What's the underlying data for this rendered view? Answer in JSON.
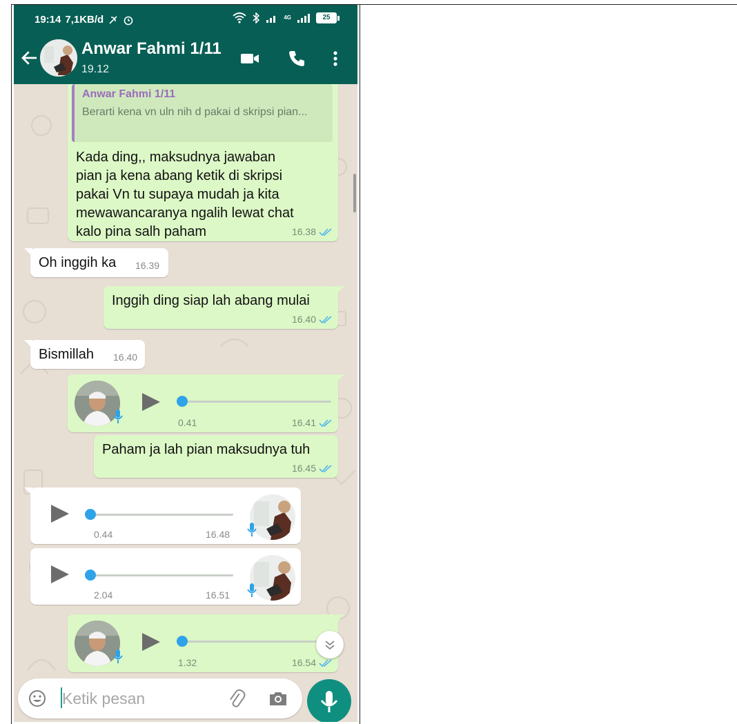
{
  "status_bar": {
    "time": "19:14",
    "speed": "7,1KB/d",
    "network_small": "4G",
    "battery": "25"
  },
  "header": {
    "contact_name": "Anwar Fahmi 1/11",
    "subtitle": "19.12"
  },
  "messages": [
    {
      "direction": "outgoing",
      "quote_name": "Anwar Fahmi 1/11",
      "quote_text": "Berarti kena vn uln nih d pakai d skripsi pian...",
      "lines": [
        "Kada ding,, maksudnya jawaban",
        "pian ja kena abang ketik di skripsi",
        "pakai Vn tu supaya mudah ja kita",
        "mewawancaranya ngalih lewat chat",
        "kalo pina salh paham"
      ],
      "time": "16.38"
    },
    {
      "direction": "incoming",
      "text": "Oh inggih ka",
      "time": "16.39"
    },
    {
      "direction": "outgoing",
      "text": "Inggih ding siap lah abang mulai",
      "time": "16.40"
    },
    {
      "direction": "incoming",
      "text": "Bismillah",
      "time": "16.40"
    },
    {
      "direction": "outgoing",
      "type": "voice",
      "duration": "0.41",
      "time": "16.41",
      "progress": 0
    },
    {
      "direction": "outgoing",
      "text": "Paham ja lah pian maksudnya tuh",
      "time": "16.45"
    },
    {
      "direction": "incoming",
      "type": "voice",
      "duration": "0.44",
      "time": "16.48",
      "progress": 0
    },
    {
      "direction": "incoming",
      "type": "voice",
      "duration": "2.04",
      "time": "16.51",
      "progress": 0
    },
    {
      "direction": "outgoing",
      "type": "voice",
      "duration": "1.32",
      "time": "16.54",
      "progress": 0
    }
  ],
  "composer": {
    "placeholder": "Ketik pesan"
  },
  "colors": {
    "header": "#075e54",
    "outgoing_bubble": "#dcf8c6",
    "incoming_bubble": "#ffffff",
    "read_ticks": "#4fb6ec",
    "mic_button": "#0f8f7f"
  },
  "icons": [
    "back-arrow-icon",
    "video-call-icon",
    "phone-icon",
    "more-vert-icon",
    "emoji-icon",
    "attach-icon",
    "camera-icon",
    "mic-icon",
    "play-icon",
    "scroll-down-icon"
  ]
}
